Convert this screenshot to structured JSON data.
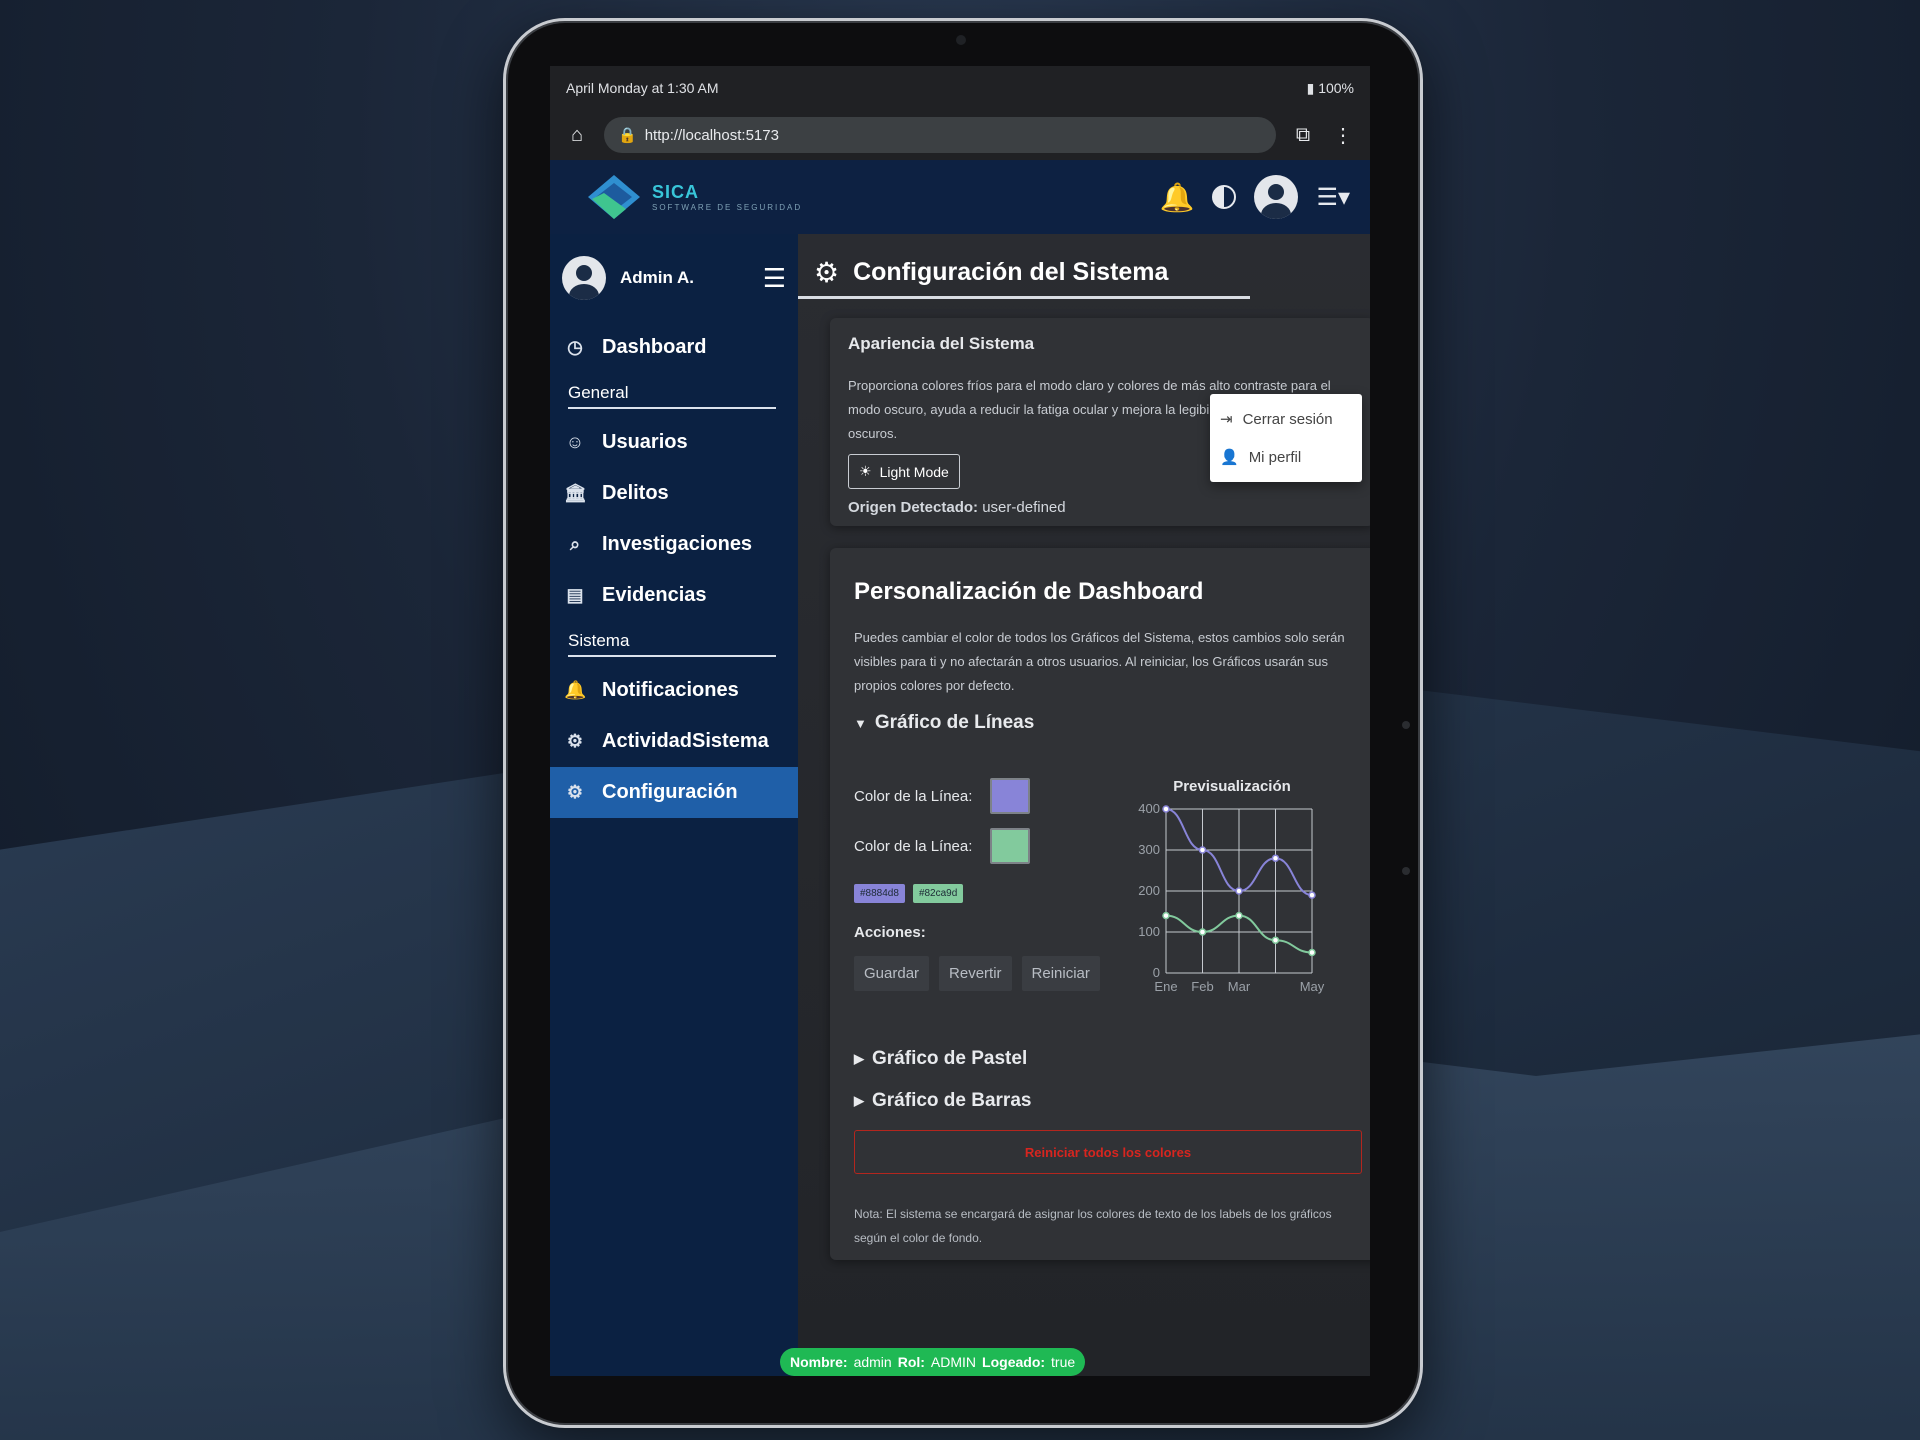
{
  "status_bar": {
    "time": "April Monday at 1:30 AM",
    "battery": "100%"
  },
  "browser": {
    "url": "http://localhost:5173"
  },
  "brand": {
    "name": "SICA",
    "tagline": "SOFTWARE DE SEGURIDAD"
  },
  "topbar": {
    "icons": {
      "notifications": "bell-icon",
      "theme": "contrast-icon",
      "profile": "avatar",
      "menu": "menu-icon"
    }
  },
  "user_menu": {
    "items": [
      {
        "label": "Cerrar sesión",
        "icon": "logout-icon"
      },
      {
        "label": "Mi perfil",
        "icon": "user-icon"
      }
    ]
  },
  "sidebar": {
    "user_name": "Admin A.",
    "items": [
      {
        "label": "Dashboard",
        "icon": "dashboard-icon"
      },
      {
        "section": "General"
      },
      {
        "label": "Usuarios",
        "icon": "users-icon"
      },
      {
        "label": "Delitos",
        "icon": "bank-icon"
      },
      {
        "label": "Investigaciones",
        "icon": "investigation-icon"
      },
      {
        "label": "Evidencias",
        "icon": "evidence-icon"
      },
      {
        "section": "Sistema"
      },
      {
        "label": "Notificaciones",
        "icon": "bell-icon"
      },
      {
        "label": "ActividadSistema",
        "icon": "activity-icon"
      },
      {
        "label": "Configuración",
        "icon": "gear-icon",
        "active": true
      }
    ],
    "active_color": "#1f5fa8"
  },
  "page": {
    "title": "Configuración del Sistema"
  },
  "appearance": {
    "title": "Apariencia del Sistema",
    "description": "Proporciona colores fríos para el modo claro y colores de más alto contraste para el modo oscuro, ayuda a reducir la fatiga ocular y mejora la legibilidad en entornos oscuros.",
    "toggle_label": "Light Mode",
    "origin_label": "Origen Detectado:",
    "origin_value": "user-defined"
  },
  "dashboard_custom": {
    "title": "Personalización de Dashboard",
    "description": "Puedes cambiar el color de todos los Gráficos del Sistema, estos cambios solo serán visibles para ti y no afectarán a otros usuarios. Al reiniciar, los Gráficos usarán sus propios colores por defecto.",
    "line_section": {
      "title": "Gráfico de Líneas",
      "color1_label": "Color de la Línea:",
      "color2_label": "Color de la Línea:",
      "color1": "#8884d8",
      "color2": "#82ca9d",
      "actions_label": "Acciones:",
      "buttons": [
        "Guardar",
        "Revertir",
        "Reiniciar"
      ],
      "preview_title": "Previsualización"
    },
    "pie_section": {
      "title": "Gráfico de Pastel"
    },
    "bar_section": {
      "title": "Gráfico de Barras"
    },
    "reset_all": "Reiniciar todos los colores",
    "note": "Nota: El sistema se encargará de asignar los colores de texto de los labels de los gráficos según el color de fondo."
  },
  "footer_badge": {
    "name_label": "Nombre:",
    "name": "admin",
    "role_label": "Rol:",
    "role": "ADMIN",
    "logged_label": "Logeado:",
    "logged": "true"
  },
  "chart_data": {
    "type": "line",
    "categories": [
      "Ene",
      "Feb",
      "Mar",
      "Abr",
      "May"
    ],
    "x_tick_labels": [
      "Ene",
      "Feb",
      "Mar",
      "May"
    ],
    "series": [
      {
        "values": [
          400,
          300,
          200,
          280,
          190
        ],
        "color": "#8884d8"
      },
      {
        "values": [
          140,
          100,
          140,
          80,
          50
        ],
        "color": "#82ca9d"
      }
    ],
    "yticks": [
      0,
      100,
      200,
      300,
      400
    ],
    "ylim": [
      0,
      400
    ],
    "grid": true
  }
}
